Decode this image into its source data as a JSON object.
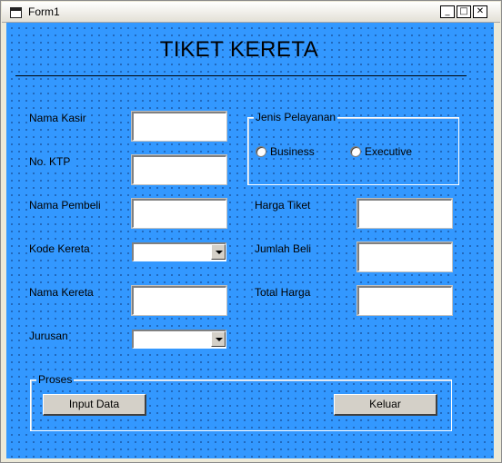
{
  "window": {
    "title": "Form1",
    "minimize": "_",
    "maximize": "□",
    "close": "✕"
  },
  "heading": "TIKET KERETA",
  "fields": {
    "nama_kasir": "Nama Kasir",
    "no_ktp": "No. KTP",
    "nama_pembeli": "Nama Pembeli",
    "kode_kereta": "Kode Kereta",
    "nama_kereta": "Nama Kereta",
    "jurusan": "Jurusan",
    "harga_tiket": "Harga Tiket",
    "jumlah_beli": "Jumlah Beli",
    "total_harga": "Total Harga"
  },
  "values": {
    "nama_kasir": "",
    "no_ktp": "",
    "nama_pembeli": "",
    "kode_kereta": "",
    "nama_kereta": "",
    "jurusan": "",
    "harga_tiket": "",
    "jumlah_beli": "",
    "total_harga": ""
  },
  "layanan": {
    "caption": "Jenis Pelayanan",
    "options": [
      "Business",
      "Executive"
    ]
  },
  "proses": {
    "caption": "Proses",
    "input_button": "Input Data",
    "exit_button": "Keluar"
  },
  "colors": {
    "form_background": "#3398ff",
    "dot_grid": "#0a2a66"
  }
}
